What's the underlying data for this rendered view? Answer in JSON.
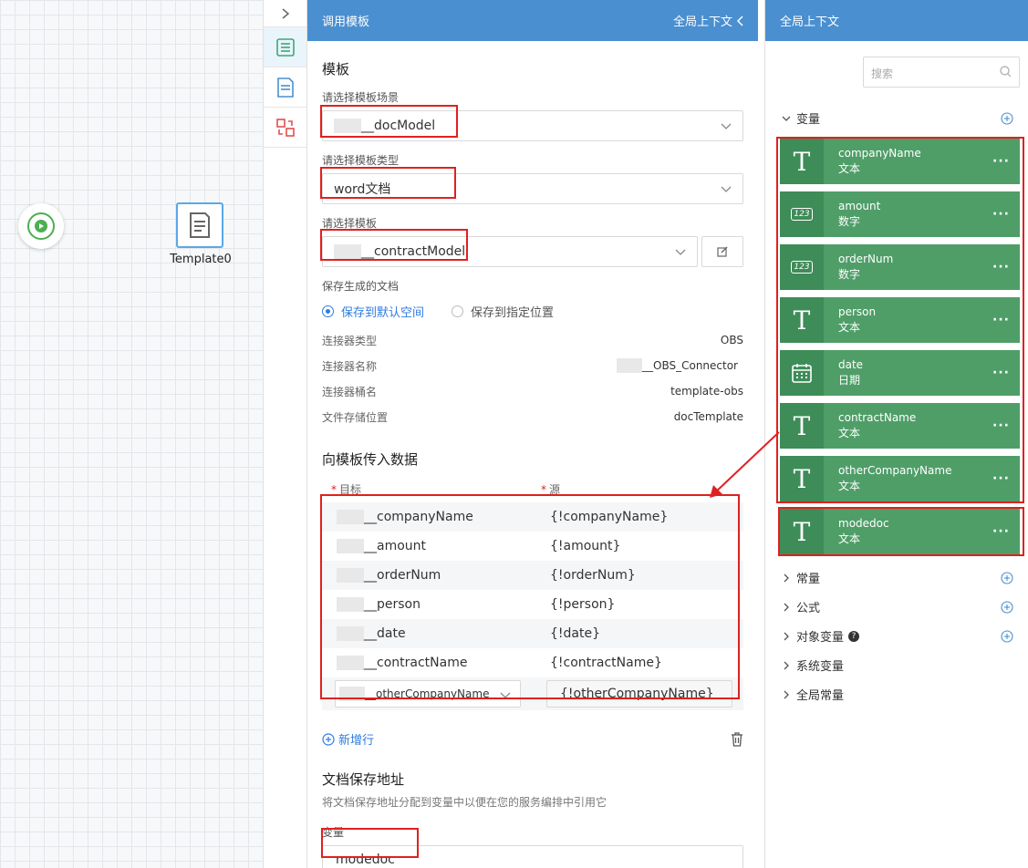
{
  "canvas": {
    "template_node_label": "Template0"
  },
  "mid_panel": {
    "header_title": "调用模板",
    "header_link": "全局上下文",
    "template_section_title": "模板",
    "scene_label": "请选择模板场景",
    "scene_value": "__docModel",
    "type_label": "请选择模板类型",
    "type_value": "word文档",
    "template_label": "请选择模板",
    "template_value": "__contractModel",
    "save_label": "保存生成的文档",
    "radio_default": "保存到默认空间",
    "radio_custom": "保存到指定位置",
    "info": [
      {
        "k": "连接器类型",
        "v": "OBS"
      },
      {
        "k": "连接器名称",
        "v": "__OBS_Connector"
      },
      {
        "k": "连接器桶名",
        "v": "template-obs"
      },
      {
        "k": "文件存储位置",
        "v": "docTemplate"
      }
    ],
    "data_section_title": "向模板传入数据",
    "col_target": "目标",
    "col_source": "源",
    "rows": [
      {
        "target": "__companyName",
        "source": "{!companyName}"
      },
      {
        "target": "__amount",
        "source": "{!amount}"
      },
      {
        "target": "__orderNum",
        "source": "{!orderNum}"
      },
      {
        "target": "__person",
        "source": "{!person}"
      },
      {
        "target": "__date",
        "source": "{!date}"
      },
      {
        "target": "__contractName",
        "source": "{!contractName}"
      }
    ],
    "edit_row": {
      "target": "__otherCompanyName",
      "source": "{!otherCompanyName}"
    },
    "add_row_label": "新增行",
    "save_addr_title": "文档保存地址",
    "save_addr_desc": "将文档保存地址分配到变量中以便在您的服务编排中引用它",
    "var_label": "变量",
    "var_value": "modedoc"
  },
  "right_panel": {
    "header_title": "全局上下文",
    "search_placeholder": "搜索",
    "variables_label": "变量",
    "variables": [
      {
        "name": "companyName",
        "type": "文本",
        "icon": "text-type-icon"
      },
      {
        "name": "amount",
        "type": "数字",
        "icon": "number-type-icon"
      },
      {
        "name": "orderNum",
        "type": "数字",
        "icon": "number-type-icon"
      },
      {
        "name": "person",
        "type": "文本",
        "icon": "text-type-icon"
      },
      {
        "name": "date",
        "type": "日期",
        "icon": "date-type-icon"
      },
      {
        "name": "contractName",
        "type": "文本",
        "icon": "text-type-icon"
      },
      {
        "name": "otherCompanyName",
        "type": "文本",
        "icon": "text-type-icon"
      },
      {
        "name": "modedoc",
        "type": "文本",
        "icon": "text-type-icon"
      }
    ],
    "tree": [
      "常量",
      "公式",
      "对象变量",
      "系统变量",
      "全局常量"
    ],
    "number_badge": "123"
  },
  "colors": {
    "header_blue": "#4a8fd0",
    "var_green": "#4f9e68",
    "highlight_red": "#e02020",
    "link_blue": "#2e7be0"
  }
}
